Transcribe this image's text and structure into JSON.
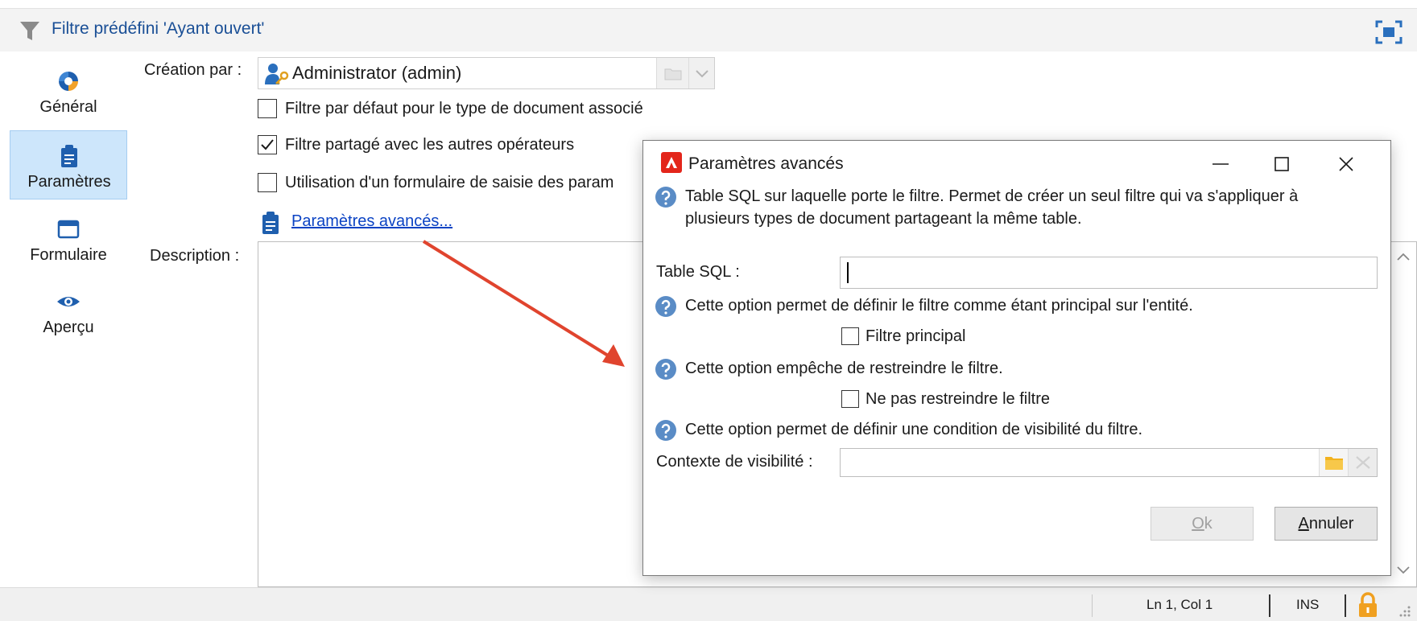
{
  "header": {
    "title": "Filtre prédéfini 'Ayant ouvert'",
    "icon": "filter-icon",
    "maximize_icon": "maximize-icon"
  },
  "nav": {
    "items": [
      {
        "label": "Général",
        "icon": "general-icon"
      },
      {
        "label": "Paramètres",
        "icon": "clipboard-icon",
        "active": true
      },
      {
        "label": "Formulaire",
        "icon": "form-icon"
      },
      {
        "label": "Aperçu",
        "icon": "eye-icon"
      }
    ]
  },
  "form": {
    "creator_label": "Création par :",
    "creator_value": "Administrator (admin)",
    "checkboxes": [
      {
        "label": "Filtre par défaut pour le type de document associé",
        "checked": false
      },
      {
        "label": "Filtre partagé avec les autres opérateurs",
        "checked": true
      },
      {
        "label": "Utilisation d'un formulaire de saisie des param",
        "checked": false
      }
    ],
    "advanced_link": "Paramètres avancés...",
    "description_label": "Description :"
  },
  "dialog": {
    "title": "Paramètres avancés",
    "help_sql_line1": "Table SQL sur laquelle porte le filtre. Permet de créer un seul filtre qui va s'appliquer à",
    "help_sql_line2": "plusieurs types de document partageant la même table.",
    "sql_label": "Table SQL :",
    "sql_value": "",
    "help_main": "Cette option permet de définir le filtre comme étant principal sur l'entité.",
    "main_checkbox": "Filtre principal",
    "help_restrict": "Cette option empêche de restreindre le filtre.",
    "restrict_checkbox": "Ne pas restreindre le filtre",
    "help_visibility": "Cette option permet de définir une condition de visibilité du filtre.",
    "visibility_label": "Contexte de visibilité :",
    "visibility_value": "",
    "ok_label": "Ok",
    "cancel_label": "Annuler"
  },
  "status": {
    "position": "Ln 1, Col 1",
    "mode": "INS"
  },
  "colors": {
    "header_title": "#1a4f96",
    "link": "#0b43c4",
    "nav_active_bg": "#cde6fb",
    "help_icon": "#5a8cc6",
    "annotation_arrow": "#e0442e",
    "lock": "#f0a020"
  }
}
